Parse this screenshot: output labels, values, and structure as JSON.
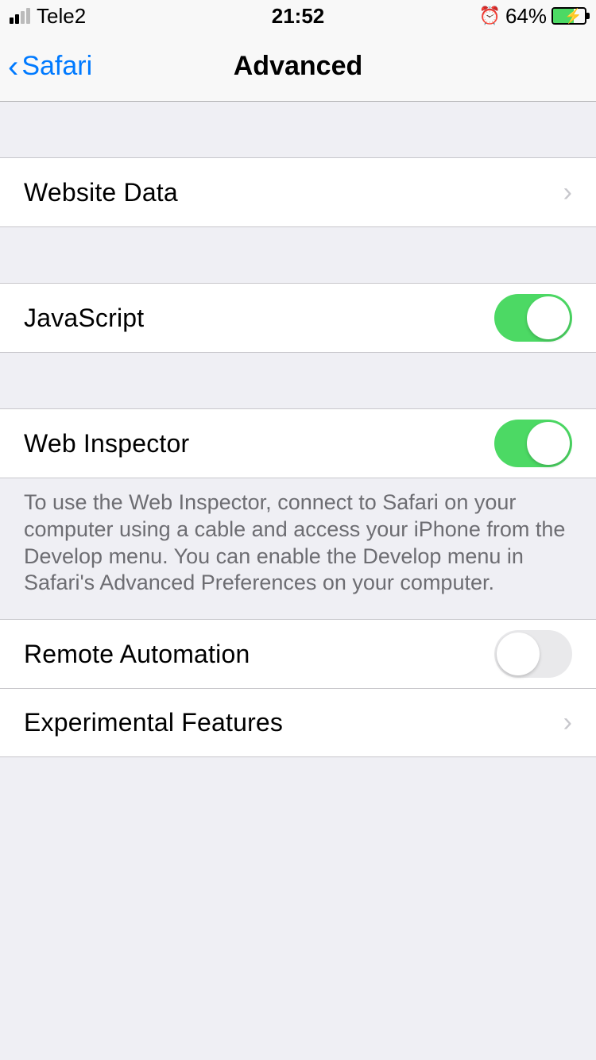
{
  "status": {
    "carrier": "Tele2",
    "time": "21:52",
    "battery_pct": "64%"
  },
  "nav": {
    "back_label": "Safari",
    "title": "Advanced"
  },
  "rows": {
    "website_data": "Website Data",
    "javascript": "JavaScript",
    "web_inspector": "Web Inspector",
    "remote_automation": "Remote Automation",
    "experimental_features": "Experimental Features"
  },
  "toggles": {
    "javascript": true,
    "web_inspector": true,
    "remote_automation": false
  },
  "footer": {
    "web_inspector_note": "To use the Web Inspector, connect to Safari on your computer using a cable and access your iPhone from the Develop menu. You can enable the Develop menu in Safari's Advanced Preferences on your computer."
  }
}
